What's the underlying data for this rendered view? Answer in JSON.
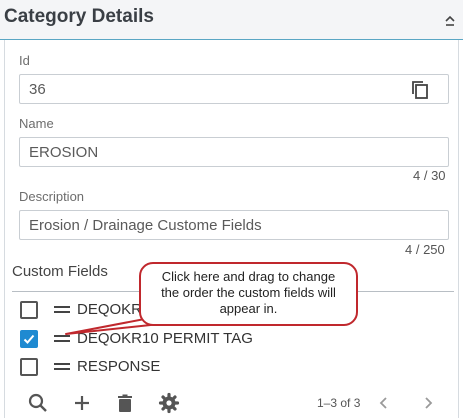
{
  "header": {
    "title": "Category Details"
  },
  "fields": {
    "id": {
      "label": "Id",
      "value": "36"
    },
    "name": {
      "label": "Name",
      "value": "EROSION",
      "counter": "4 / 30"
    },
    "description": {
      "label": "Description",
      "value": "Erosion / Drainage Custome Fields",
      "counter": "4 / 250"
    }
  },
  "custom_fields": {
    "title": "Custom Fields",
    "items": [
      {
        "label": "DEQOKR",
        "checked": false
      },
      {
        "label": "DEQOKR10 PERMIT TAG",
        "checked": true
      },
      {
        "label": "RESPONSE",
        "checked": false
      }
    ]
  },
  "toolbar": {
    "icons": [
      "search-icon",
      "add-icon",
      "delete-icon",
      "settings-icon"
    ]
  },
  "pager": {
    "range": "1–3 of 3"
  },
  "callout": {
    "text": "Click here and drag to change the order the custom fields will appear in."
  },
  "colors": {
    "accent": "#1f8ad1",
    "callout_border": "#c0282d",
    "header_rule": "#5aa6c4"
  }
}
